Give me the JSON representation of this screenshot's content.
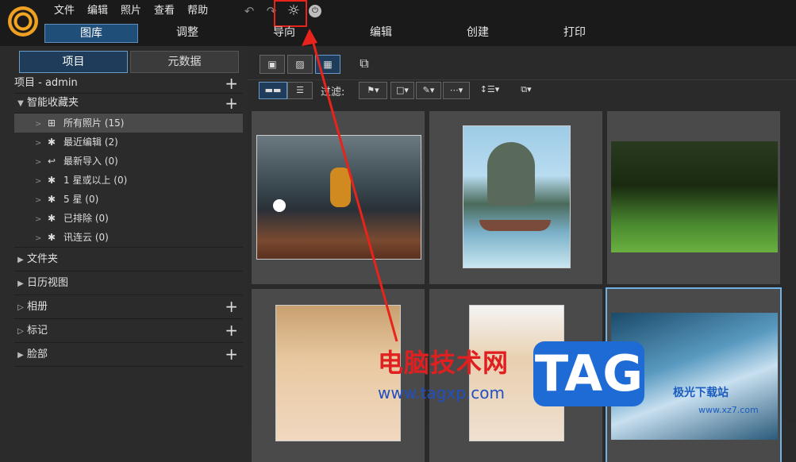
{
  "menu": [
    "文件",
    "编辑",
    "照片",
    "查看",
    "帮助"
  ],
  "modes": [
    "图库",
    "调整",
    "导向",
    "编辑",
    "创建",
    "打印"
  ],
  "left_tabs": [
    "项目",
    "元数据"
  ],
  "tree": {
    "project": "项目 - admin",
    "smart_collections": "智能收藏夹",
    "items": [
      {
        "label": "所有照片 (15)",
        "icon": "hierarchy-icon",
        "selected": true
      },
      {
        "label": "最近编辑 (2)",
        "icon": "sparkle-icon"
      },
      {
        "label": "最新导入 (0)",
        "icon": "import-icon"
      },
      {
        "label": "1 星或以上 (0)",
        "icon": "sparkle-icon"
      },
      {
        "label": "5 星 (0)",
        "icon": "sparkle-icon"
      },
      {
        "label": "已排除 (0)",
        "icon": "sparkle-icon"
      },
      {
        "label": "讯连云 (0)",
        "icon": "sparkle-icon"
      }
    ],
    "folders": "文件夹",
    "calendar": "日历视图",
    "albums": "相册",
    "tags": "标记",
    "faces": "脸部"
  },
  "filter_label": "过滤:",
  "watermark": {
    "cn": "电脑技术网",
    "url": "www.tagxp.com",
    "tag": "TAG",
    "site2": "极光下载站",
    "site2_url": "www.xz7.com"
  },
  "colors": {
    "accent": "#1f4e79",
    "highlight": "#e8231b",
    "selected": "#6fb2e6"
  }
}
